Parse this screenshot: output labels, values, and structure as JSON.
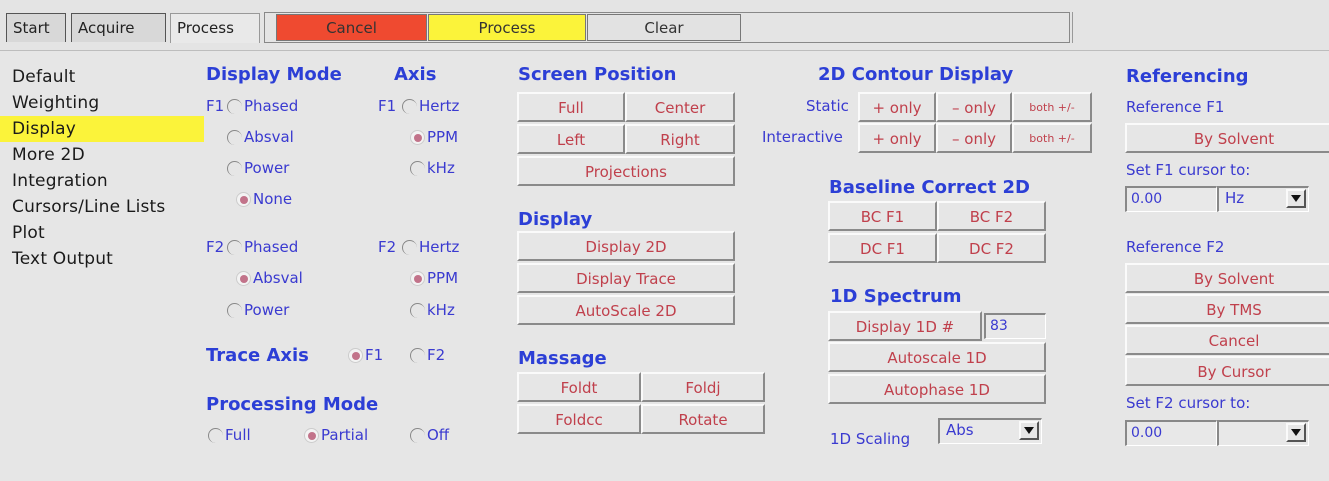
{
  "tabs": [
    "Start",
    "Acquire",
    "Process"
  ],
  "toolbar": {
    "cancel": "Cancel",
    "process": "Process",
    "clear": "Clear"
  },
  "colors": {
    "cancel_bg": "#ef4a30",
    "process_bg": "#fbf33a",
    "selected_item": "#fbf33a",
    "label": "#3a3ad0",
    "button_text": "#c0404c"
  },
  "sidebar": {
    "items": [
      "Default",
      "Weighting",
      "Display",
      "More 2D",
      "Integration",
      "Cursors/Line Lists",
      "Plot",
      "Text Output"
    ],
    "selected": "Display"
  },
  "display_mode": {
    "title": "Display Mode",
    "f1_label": "F1",
    "f1_options": [
      "Phased",
      "Absval",
      "Power",
      "None"
    ],
    "f1_selected": "None",
    "f2_label": "F2",
    "f2_options": [
      "Phased",
      "Absval",
      "Power"
    ],
    "f2_selected": "Absval"
  },
  "axis": {
    "title": "Axis",
    "f1_label": "F1",
    "f1_options": [
      "Hertz",
      "PPM",
      "kHz"
    ],
    "f1_selected": "PPM",
    "f2_label": "F2",
    "f2_options": [
      "Hertz",
      "PPM",
      "kHz"
    ],
    "f2_selected": "PPM"
  },
  "trace_axis": {
    "title": "Trace Axis",
    "options": [
      "F1",
      "F2"
    ],
    "selected": "F1"
  },
  "processing_mode": {
    "title": "Processing Mode",
    "options": [
      "Full",
      "Partial",
      "Off"
    ],
    "selected": "Partial"
  },
  "screen_position": {
    "title": "Screen Position",
    "full": "Full",
    "center": "Center",
    "left": "Left",
    "right": "Right",
    "projections": "Projections"
  },
  "display": {
    "title": "Display",
    "display2d": "Display 2D",
    "display_trace": "Display Trace",
    "autoscale2d": "AutoScale 2D"
  },
  "massage": {
    "title": "Massage",
    "foldt": "Foldt",
    "foldj": "Foldj",
    "foldcc": "Foldcc",
    "rotate": "Rotate"
  },
  "contour": {
    "title": "2D Contour Display",
    "static_label": "Static",
    "interactive_label": "Interactive",
    "plus_only": "+ only",
    "minus_only": "– only",
    "both": "both +/-"
  },
  "baseline": {
    "title": "Baseline Correct 2D",
    "bcf1": "BC F1",
    "bcf2": "BC F2",
    "dcf1": "DC F1",
    "dcf2": "DC F2"
  },
  "spectrum1d": {
    "title": "1D Spectrum",
    "display1d": "Display 1D #",
    "display1d_value": "83",
    "autoscale": "Autoscale 1D",
    "autophase": "Autophase 1D"
  },
  "scaling1d": {
    "label": "1D Scaling",
    "value": "Abs"
  },
  "referencing": {
    "title": "Referencing",
    "ref_f1": "Reference F1",
    "by_solvent_f1": "By Solvent",
    "set_f1": "Set F1 cursor to:",
    "f1_value": "0.00",
    "f1_unit": "Hz",
    "ref_f2": "Reference F2",
    "by_solvent_f2": "By Solvent",
    "by_tms": "By TMS",
    "cancel": "Cancel",
    "by_cursor": "By Cursor",
    "set_f2": "Set F2 cursor to:",
    "f2_value": "0.00",
    "f2_unit": ""
  },
  "icons": {
    "dropdown_arrow": "chevron-down-icon",
    "radio_on": "radio-selected-icon",
    "radio_off": "radio-unselected-icon"
  }
}
